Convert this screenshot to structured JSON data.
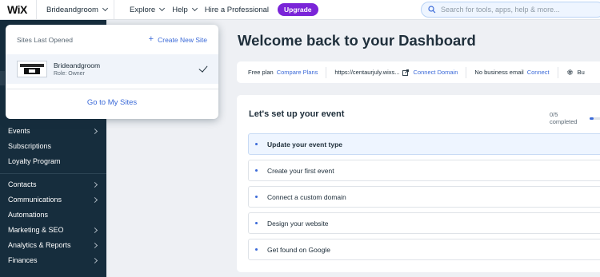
{
  "topbar": {
    "logo": "WiX",
    "site_name": "Brideandgroom",
    "nav": [
      {
        "label": "Explore",
        "has_chevron": true
      },
      {
        "label": "Help",
        "has_chevron": true
      },
      {
        "label": "Hire a Professional",
        "has_chevron": false
      }
    ],
    "upgrade_label": "Upgrade",
    "search_placeholder": "Search for tools, apps, help & more...",
    "accent_color": "#7a24d8"
  },
  "dropdown": {
    "header": "Sites Last Opened",
    "create_label": "Create New Site",
    "site": {
      "name": "Brideandgroom",
      "role": "Role: Owner",
      "selected": true
    },
    "goto_label": "Go to My Sites"
  },
  "sidebar": {
    "items": [
      {
        "label": "Events",
        "has_chevron": true
      },
      {
        "label": "Subscriptions",
        "has_chevron": false
      },
      {
        "label": "Loyalty Program",
        "has_chevron": false
      },
      {
        "label": "Contacts",
        "has_chevron": true
      },
      {
        "label": "Communications",
        "has_chevron": true
      },
      {
        "label": "Automations",
        "has_chevron": false
      },
      {
        "label": "Marketing & SEO",
        "has_chevron": true
      },
      {
        "label": "Analytics & Reports",
        "has_chevron": true
      },
      {
        "label": "Finances",
        "has_chevron": true
      }
    ]
  },
  "main": {
    "title": "Welcome back to your Dashboard",
    "info_bar": {
      "plan_text": "Free plan",
      "compare_label": "Compare Plans",
      "url": "https://centaurjuly.wixs...",
      "connect_domain_label": "Connect Domain",
      "email_text": "No business email",
      "connect_label": "Connect",
      "truncated_label": "Bu"
    },
    "setup": {
      "title": "Let's set up your event",
      "progress_text": "0/5 completed",
      "progress_fraction": 0.15,
      "steps": [
        {
          "label": "Update your event type",
          "active": true
        },
        {
          "label": "Create your first event",
          "active": false
        },
        {
          "label": "Connect a custom domain",
          "active": false
        },
        {
          "label": "Design your website",
          "active": false
        },
        {
          "label": "Get found on Google",
          "active": false
        }
      ]
    }
  }
}
